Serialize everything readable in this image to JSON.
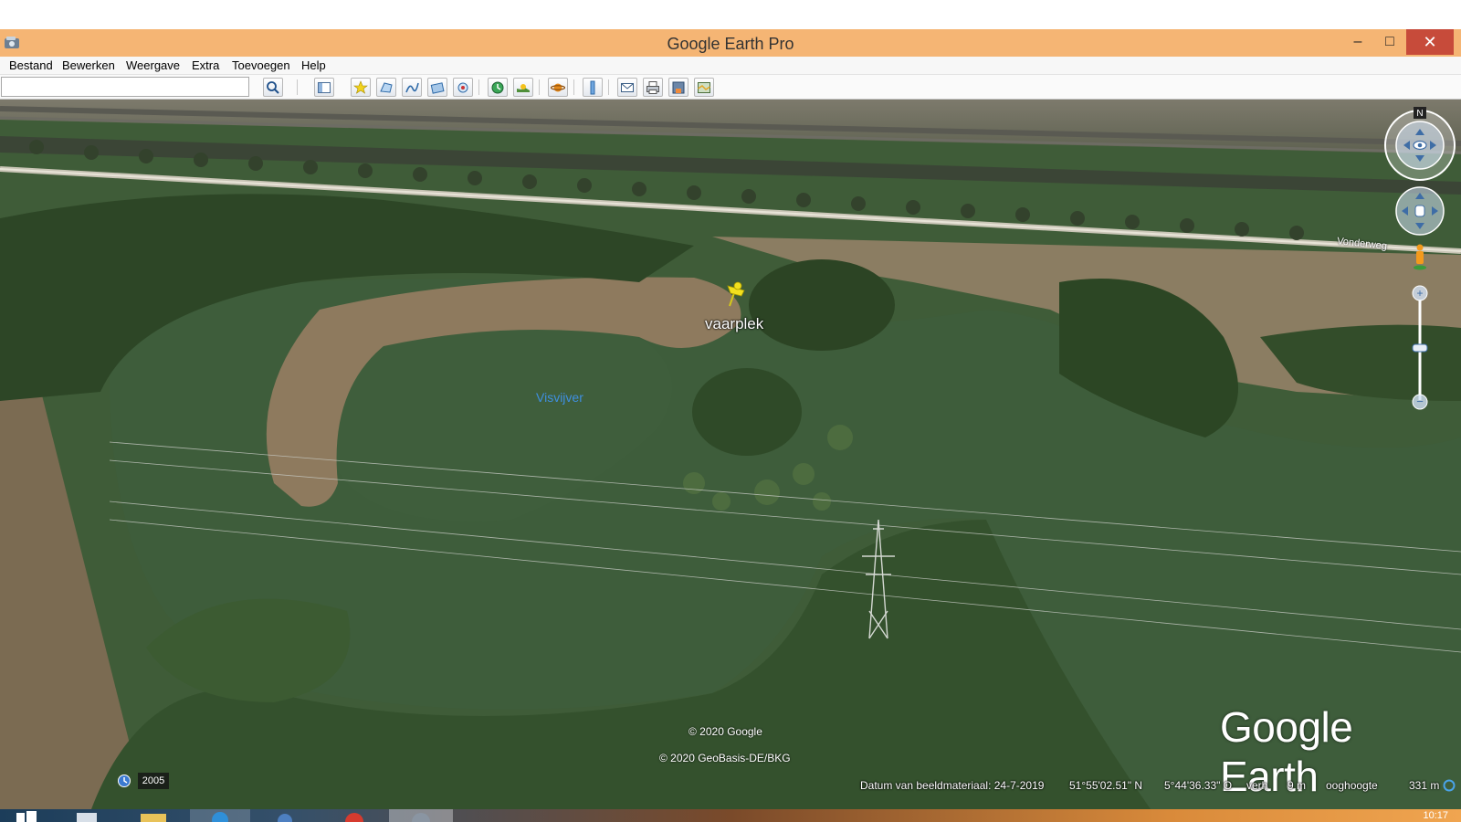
{
  "window": {
    "title": "Google Earth Pro",
    "minimize_label": "–",
    "maximize_label": "□",
    "close_label": "✕"
  },
  "menu": {
    "items": [
      {
        "label": "Bestand"
      },
      {
        "label": "Bewerken"
      },
      {
        "label": "Weergave"
      },
      {
        "label": "Extra"
      },
      {
        "label": "Toevoegen"
      },
      {
        "label": "Help"
      }
    ]
  },
  "search": {
    "value": "",
    "placeholder": ""
  },
  "toolbar_icons": [
    "search-icon",
    "sidebar-toggle-icon",
    "add-placemark-icon",
    "add-polygon-icon",
    "add-path-icon",
    "add-image-overlay-icon",
    "record-tour-icon",
    "historical-imagery-icon",
    "sunlight-icon",
    "switch-to-sky-icon",
    "ruler-icon",
    "email-icon",
    "print-icon",
    "save-image-icon",
    "view-in-maps-icon"
  ],
  "map": {
    "placemark_label": "vaarplek",
    "lake_label": "Visvijver",
    "road_label": "Vonderweg",
    "copyright_google": "© 2020 Google",
    "copyright_geobasis": "© 2020 GeoBasis-DE/BKG",
    "logo_text": "Google Earth",
    "compass_north": "N"
  },
  "status": {
    "imagery_year": "2005",
    "imagery_date": "Datum van beeldmateriaal: 24-7-2019",
    "latitude": "51°55'02.51\" N",
    "longitude": "5°44'36.33\" O",
    "elevation_label": "verh",
    "elevation_value": "9 m",
    "eye_alt_label": "ooghoogte",
    "eye_alt_value": "331 m"
  },
  "taskbar": {
    "clock": "10:17"
  },
  "colors": {
    "title_bar": "#f5b574",
    "close_button": "#c74b3a",
    "lake_label": "#3f8fe0",
    "placemark_pin": "#f2e01e"
  }
}
